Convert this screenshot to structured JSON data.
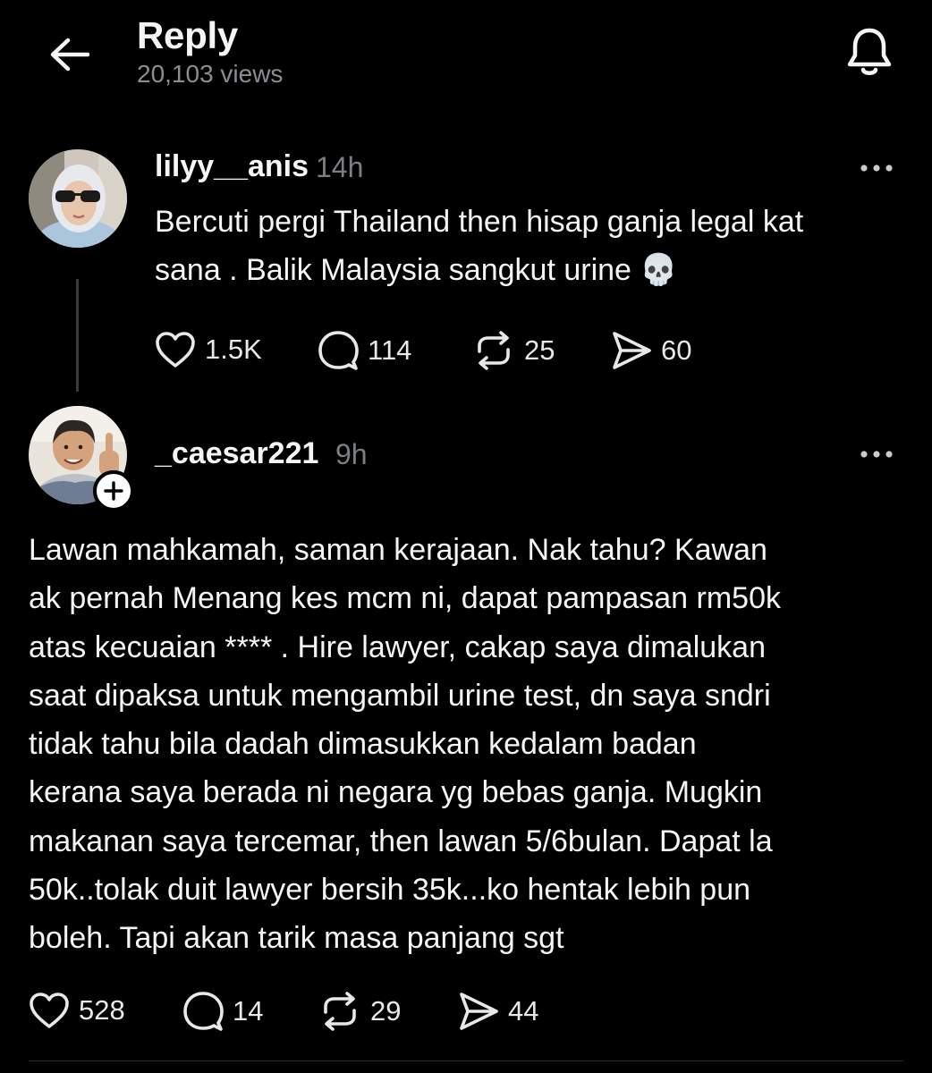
{
  "header": {
    "title": "Reply",
    "views": "20,103 views"
  },
  "post": {
    "username": "lilyy__anis",
    "time": "14h",
    "text": "Bercuti pergi Thailand then hisap ganja legal kat\nsana . Balik Malaysia sangkut urine 💀",
    "likes": "1.5K",
    "replies": "114",
    "reposts": "25",
    "shares": "60"
  },
  "reply": {
    "username": "_caesar221",
    "time": "9h",
    "text": "Lawan mahkamah, saman kerajaan. Nak tahu? Kawan\nak pernah Menang kes mcm ni, dapat pampasan rm50k\natas kecuaian **** . Hire lawyer, cakap saya dimalukan\nsaat dipaksa untuk mengambil urine test, dn saya sndri\ntidak tahu bila dadah dimasukkan kedalam badan\nkerana saya berada ni negara yg bebas ganja. Mugkin\nmakanan saya tercemar, then lawan 5/6bulan. Dapat la\n50k..tolak duit lawyer bersih 35k...ko hentak lebih pun\nboleh. Tapi akan tarik masa panjang sgt",
    "likes": "528",
    "replies": "14",
    "reposts": "29",
    "shares": "44"
  },
  "icons": {
    "back": "arrow-left-icon",
    "notifications": "bell-icon",
    "more": "more-horizontal-icon",
    "like": "heart-icon",
    "comment": "speech-bubble-icon",
    "repost": "repost-icon",
    "share": "send-icon",
    "follow": "plus-icon"
  },
  "colors": {
    "background": "#000000",
    "text": "#f3f5f7",
    "muted": "#8a8d91"
  }
}
